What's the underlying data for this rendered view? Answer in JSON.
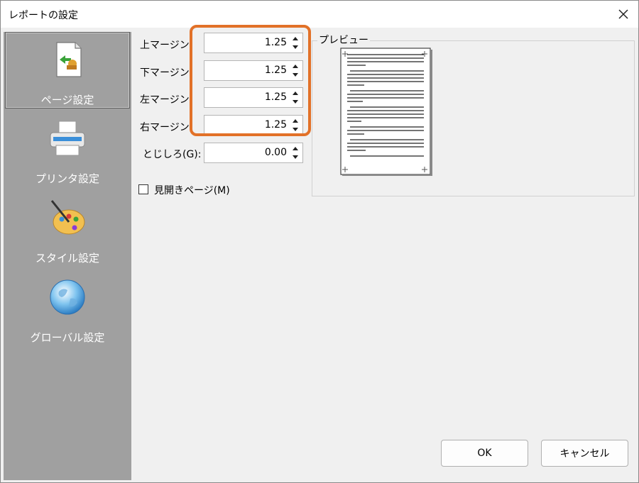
{
  "window": {
    "title": "レポートの設定"
  },
  "sidebar": {
    "items": [
      {
        "label": "ページ設定",
        "icon": "page-setup-icon",
        "selected": true
      },
      {
        "label": "プリンタ設定",
        "icon": "printer-icon",
        "selected": false
      },
      {
        "label": "スタイル設定",
        "icon": "palette-icon",
        "selected": false
      },
      {
        "label": "グローバル設定",
        "icon": "globe-icon",
        "selected": false
      }
    ]
  },
  "margins": {
    "top": {
      "label": "上マージン",
      "value": "1.25"
    },
    "bottom": {
      "label": "下マージン",
      "value": "1.25"
    },
    "left": {
      "label": "左マージン",
      "value": "1.25"
    },
    "right": {
      "label": "右マージン",
      "value": "1.25"
    },
    "gutter": {
      "label": "とじしろ(G):",
      "value": "0.00"
    }
  },
  "facing_pages": {
    "label": "見開きページ(M)",
    "checked": false
  },
  "preview": {
    "title": "プレビュー"
  },
  "buttons": {
    "ok": "OK",
    "cancel": "キャンセル"
  },
  "colors": {
    "highlight": "#e27128",
    "sidebar": "#a0a0a0"
  }
}
